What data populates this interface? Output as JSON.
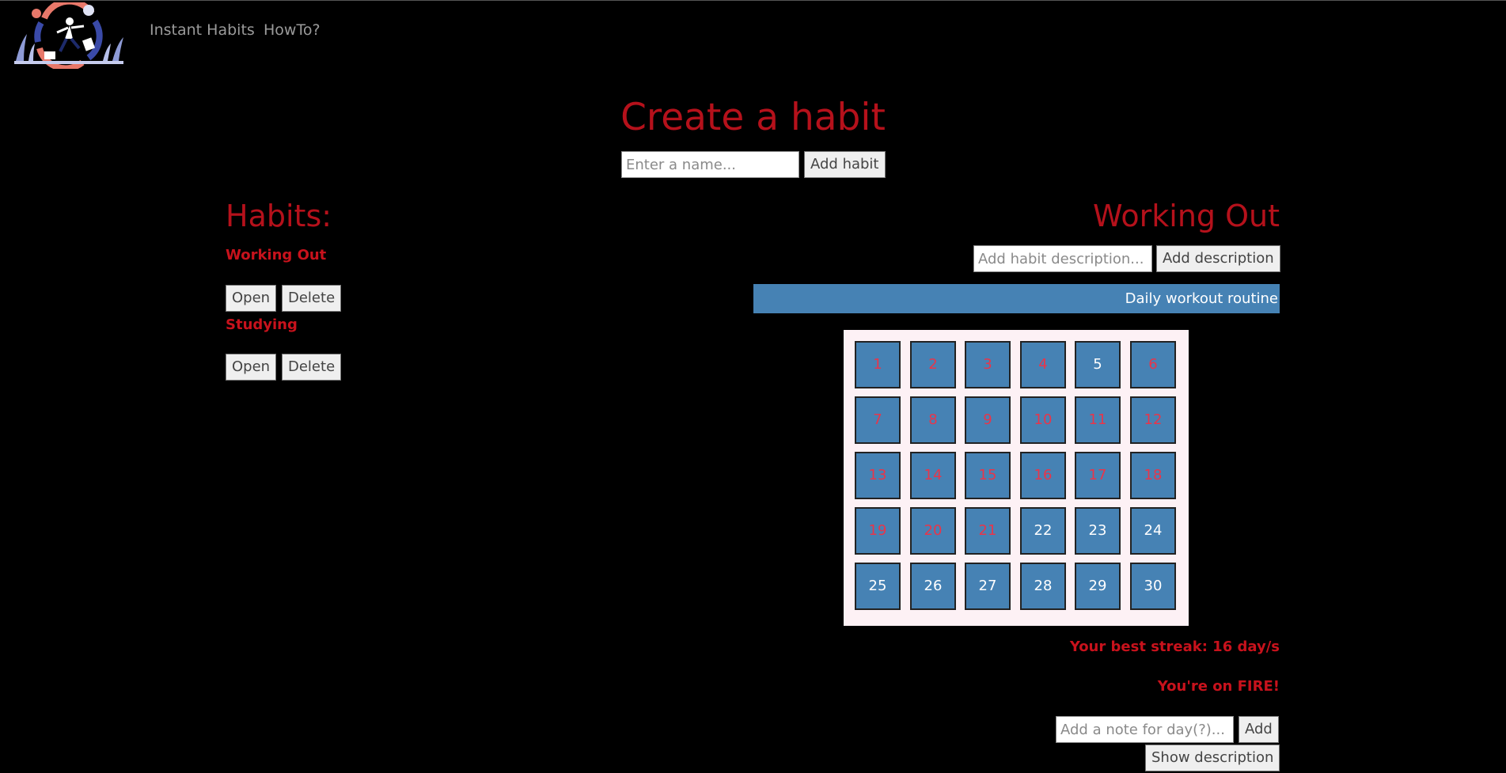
{
  "nav": {
    "logo_alt": "Instant Habits logo",
    "links": [
      "Instant Habits",
      "HowTo?"
    ]
  },
  "create": {
    "title": "Create a habit",
    "name_placeholder": "Enter a name...",
    "add_label": "Add habit"
  },
  "habits": {
    "heading": "Habits:",
    "items": [
      {
        "name": "Working Out",
        "open_label": "Open",
        "delete_label": "Delete"
      },
      {
        "name": "Studying",
        "open_label": "Open",
        "delete_label": "Delete"
      }
    ]
  },
  "detail": {
    "title": "Working Out",
    "desc_placeholder": "Add habit description...",
    "add_desc_label": "Add description",
    "description": "Daily workout routine",
    "days": [
      {
        "n": "1",
        "done": true
      },
      {
        "n": "2",
        "done": true
      },
      {
        "n": "3",
        "done": true
      },
      {
        "n": "4",
        "done": true
      },
      {
        "n": "5",
        "done": false
      },
      {
        "n": "6",
        "done": true
      },
      {
        "n": "7",
        "done": true
      },
      {
        "n": "8",
        "done": true
      },
      {
        "n": "9",
        "done": true
      },
      {
        "n": "10",
        "done": true
      },
      {
        "n": "11",
        "done": true
      },
      {
        "n": "12",
        "done": true
      },
      {
        "n": "13",
        "done": true
      },
      {
        "n": "14",
        "done": true
      },
      {
        "n": "15",
        "done": true
      },
      {
        "n": "16",
        "done": true
      },
      {
        "n": "17",
        "done": true
      },
      {
        "n": "18",
        "done": true
      },
      {
        "n": "19",
        "done": true
      },
      {
        "n": "20",
        "done": true
      },
      {
        "n": "21",
        "done": true
      },
      {
        "n": "22",
        "done": false
      },
      {
        "n": "23",
        "done": false
      },
      {
        "n": "24",
        "done": false
      },
      {
        "n": "25",
        "done": false
      },
      {
        "n": "26",
        "done": false
      },
      {
        "n": "27",
        "done": false
      },
      {
        "n": "28",
        "done": false
      },
      {
        "n": "29",
        "done": false
      },
      {
        "n": "30",
        "done": false
      }
    ],
    "streak_text": "Your best streak: 16 day/s",
    "fire_text": "You're on FIRE!",
    "note_placeholder": "Add a note for day(?)...",
    "note_add_label": "Add",
    "show_desc_label": "Show description"
  },
  "colors": {
    "background": "#000000",
    "accent_red": "#b5111b",
    "day_blue": "#4682b4",
    "day_done_text": "#e8354a",
    "calendar_bg": "#fdf1f5"
  }
}
